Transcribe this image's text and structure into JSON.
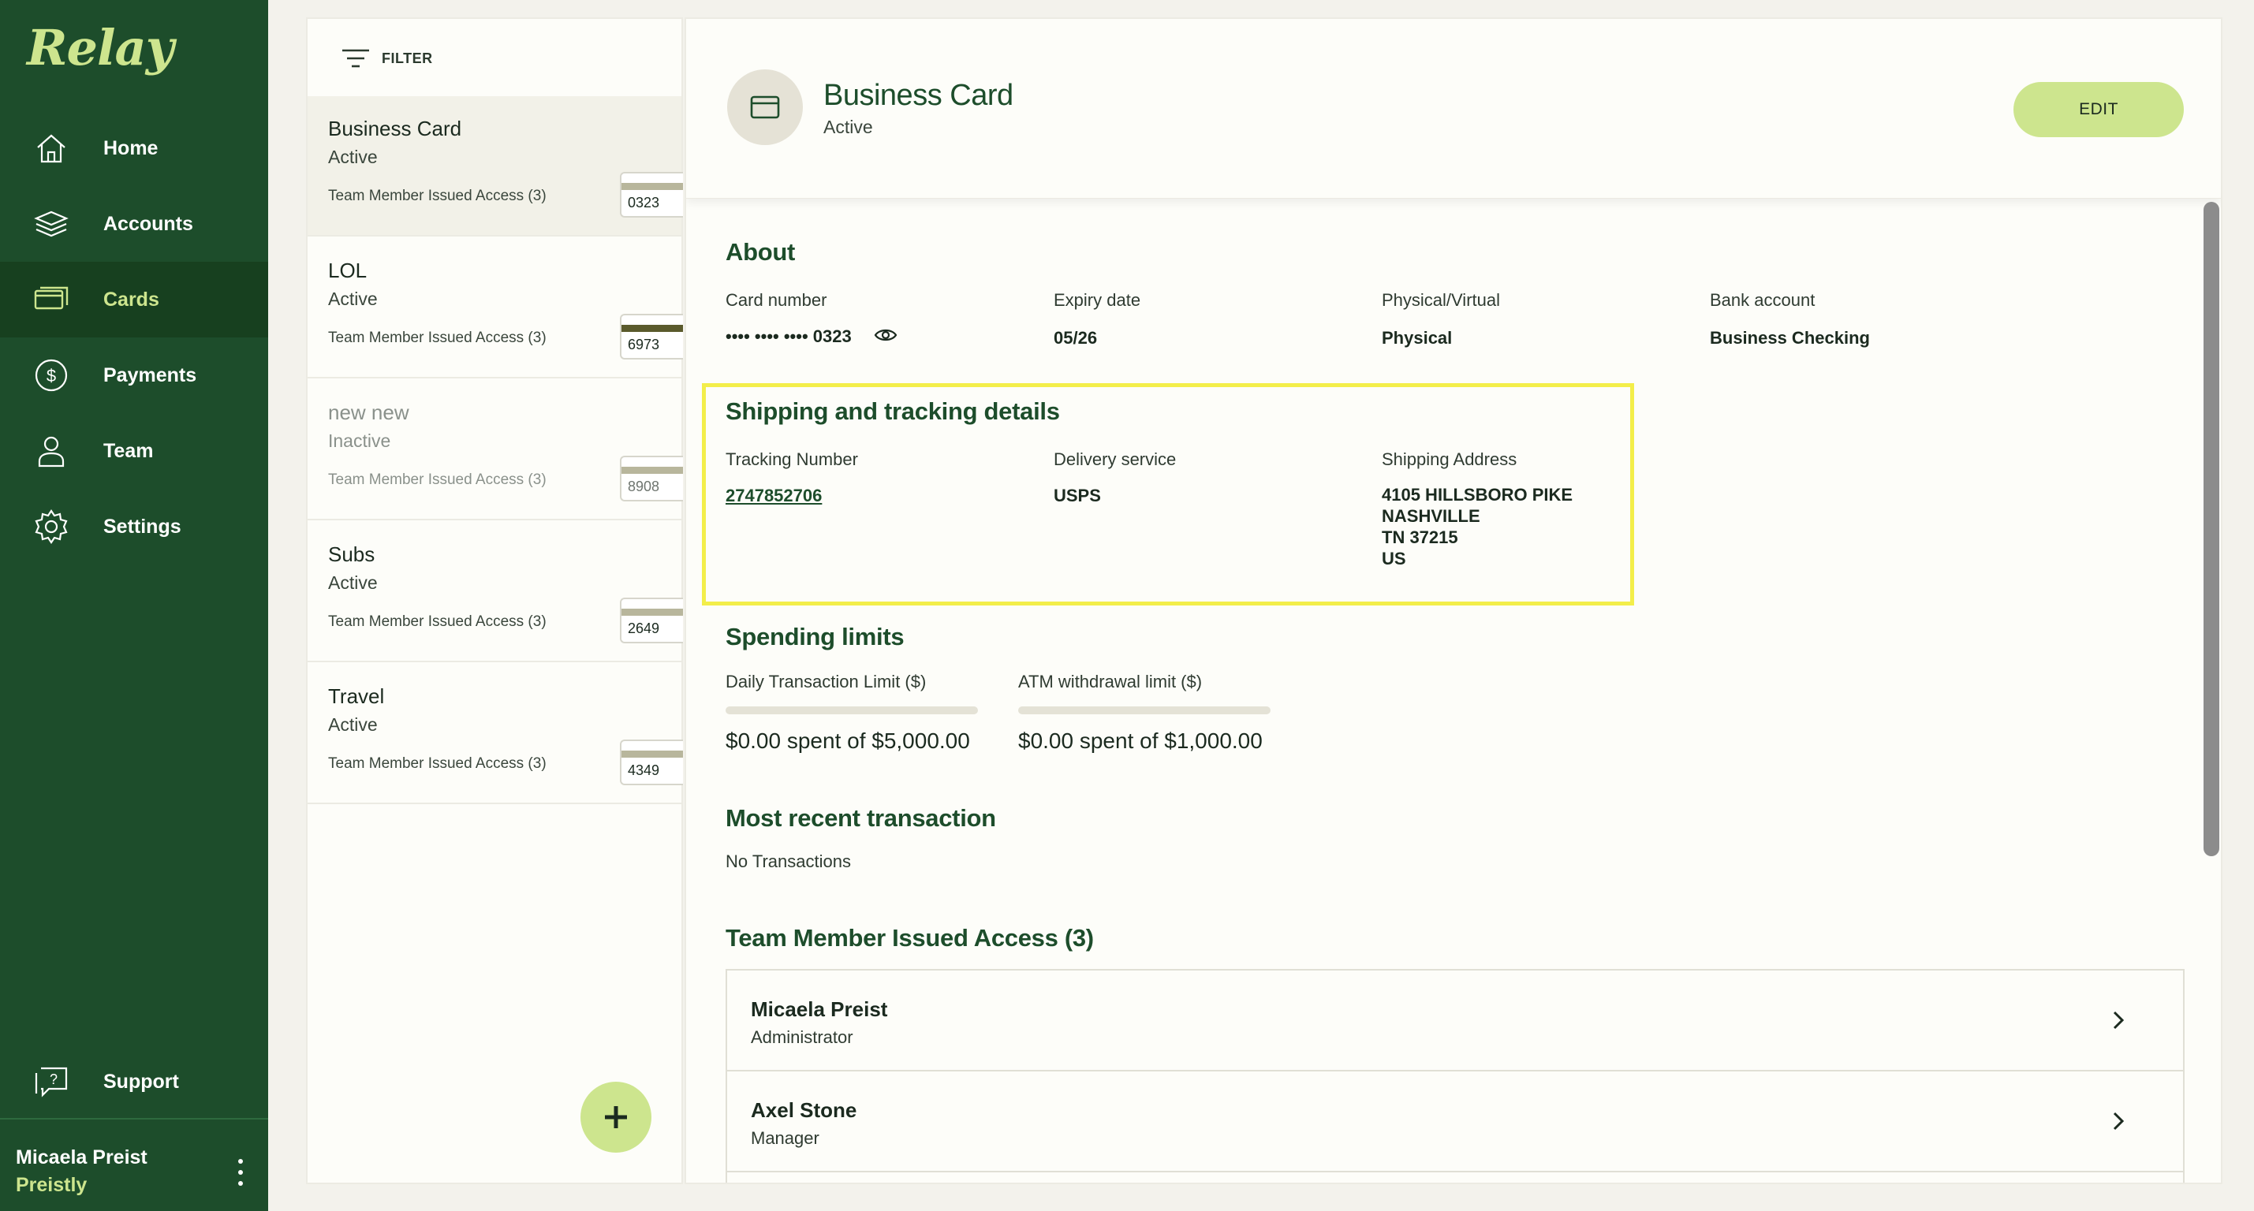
{
  "app": {
    "logo_text": "Relay"
  },
  "sidebar": {
    "items": [
      {
        "label": "Home",
        "icon": "home-icon"
      },
      {
        "label": "Accounts",
        "icon": "layers-icon"
      },
      {
        "label": "Cards",
        "icon": "card-icon",
        "active": true
      },
      {
        "label": "Payments",
        "icon": "dollar-circle-icon"
      },
      {
        "label": "Team",
        "icon": "person-icon"
      },
      {
        "label": "Settings",
        "icon": "gear-icon"
      }
    ],
    "support": {
      "label": "Support",
      "icon": "help-chat-icon"
    },
    "user": {
      "name": "Micaela Preist",
      "org": "Preistly"
    }
  },
  "card_list": {
    "filter_label": "FILTER",
    "cards": [
      {
        "name": "Business Card",
        "status": "Active",
        "access": "Team Member Issued Access (3)",
        "last4": "0323",
        "selected": true
      },
      {
        "name": "LOL",
        "status": "Active",
        "access": "Team Member Issued Access (3)",
        "last4": "6973"
      },
      {
        "name": "new new",
        "status": "Inactive",
        "access": "Team Member Issued Access (3)",
        "last4": "8908"
      },
      {
        "name": "Subs",
        "status": "Active",
        "access": "Team Member Issued Access (3)",
        "last4": "2649"
      },
      {
        "name": "Travel",
        "status": "Active",
        "access": "Team Member Issued Access (3)",
        "last4": "4349"
      }
    ]
  },
  "detail": {
    "title": "Business Card",
    "status": "Active",
    "edit_label": "EDIT",
    "about": {
      "title": "About",
      "card_number_label": "Card number",
      "card_number_value": "•••• •••• •••• 0323",
      "expiry_label": "Expiry date",
      "expiry_value": "05/26",
      "type_label": "Physical/Virtual",
      "type_value": "Physical",
      "bank_label": "Bank account",
      "bank_value": "Business Checking"
    },
    "shipping": {
      "title": "Shipping and tracking details",
      "tracking_label": "Tracking Number",
      "tracking_value": "2747852706",
      "delivery_label": "Delivery service",
      "delivery_value": "USPS",
      "address_label": "Shipping Address",
      "address_lines": [
        "4105 HILLSBORO PIKE",
        "NASHVILLE",
        "TN 37215",
        "US"
      ]
    },
    "limits": {
      "title": "Spending limits",
      "daily_label": "Daily Transaction Limit ($)",
      "daily_text": "$0.00 spent of $5,000.00",
      "daily_fraction": 0,
      "atm_label": "ATM withdrawal limit ($)",
      "atm_text": "$0.00 spent of $1,000.00",
      "atm_fraction": 0
    },
    "recent": {
      "title": "Most recent transaction",
      "empty_text": "No Transactions"
    },
    "members": {
      "title": "Team Member Issued Access (3)",
      "list": [
        {
          "name": "Micaela Preist",
          "role": "Administrator"
        },
        {
          "name": "Axel Stone",
          "role": "Manager"
        }
      ]
    }
  },
  "colors": {
    "sidebar_bg": "#1d4d2b",
    "accent": "#cde58e",
    "highlight": "#f3ee4a"
  }
}
